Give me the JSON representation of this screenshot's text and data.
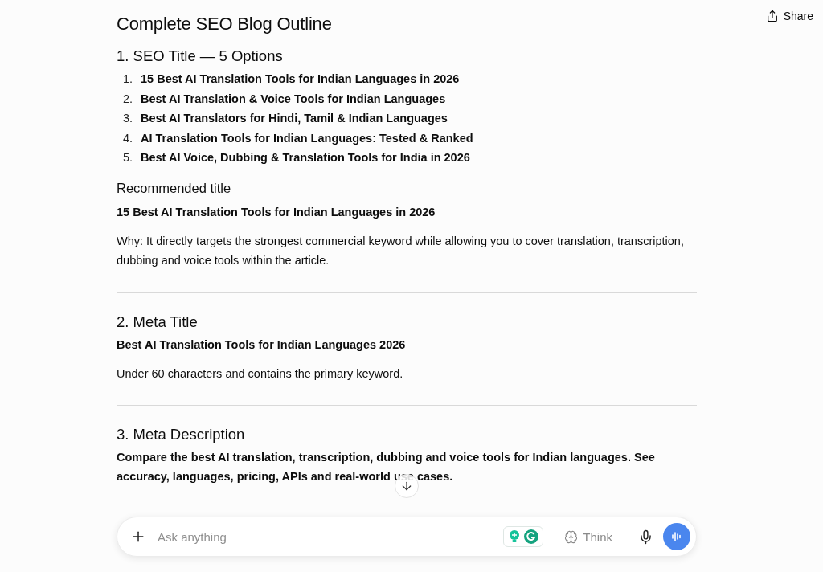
{
  "header": {
    "share_label": "Share"
  },
  "blocks": [
    {
      "kind": "h1",
      "text": "Complete SEO Blog Outline"
    },
    {
      "kind": "h2",
      "text": "1. SEO Title — 5 Options"
    },
    {
      "kind": "ol",
      "items": [
        {
          "number": "1.",
          "text": "15 Best AI Translation Tools for Indian Languages in 2026"
        },
        {
          "number": "2.",
          "text": "Best AI Translation & Voice Tools for Indian Languages"
        },
        {
          "number": "3.",
          "text": "Best AI Translators for Hindi, Tamil & Indian Languages"
        },
        {
          "number": "4.",
          "text": "AI Translation Tools for Indian Languages: Tested & Ranked"
        },
        {
          "number": "5.",
          "text": "Best AI Voice, Dubbing & Translation Tools for India in 2026"
        }
      ]
    },
    {
      "kind": "h3",
      "text": "Recommended title"
    },
    {
      "kind": "strong",
      "text": "15 Best AI Translation Tools for Indian Languages in 2026"
    },
    {
      "kind": "para",
      "text": "Why: It directly targets the strongest commercial keyword while allowing you to cover translation, transcription, dubbing and voice tools within the article."
    },
    {
      "kind": "divider"
    },
    {
      "kind": "h2",
      "text": "2. Meta Title"
    },
    {
      "kind": "strong",
      "text": "Best AI Translation Tools for Indian Languages 2026"
    },
    {
      "kind": "para",
      "text": "Under 60 characters and contains the primary keyword."
    },
    {
      "kind": "divider"
    },
    {
      "kind": "h2",
      "text": "3. Meta Description"
    },
    {
      "kind": "strong",
      "text": "Compare the best AI translation, transcription, dubbing and voice tools for Indian languages. See accuracy, languages, pricing, APIs and real-world use cases."
    }
  ],
  "composer": {
    "placeholder": "Ask anything",
    "think_label": "Think"
  }
}
